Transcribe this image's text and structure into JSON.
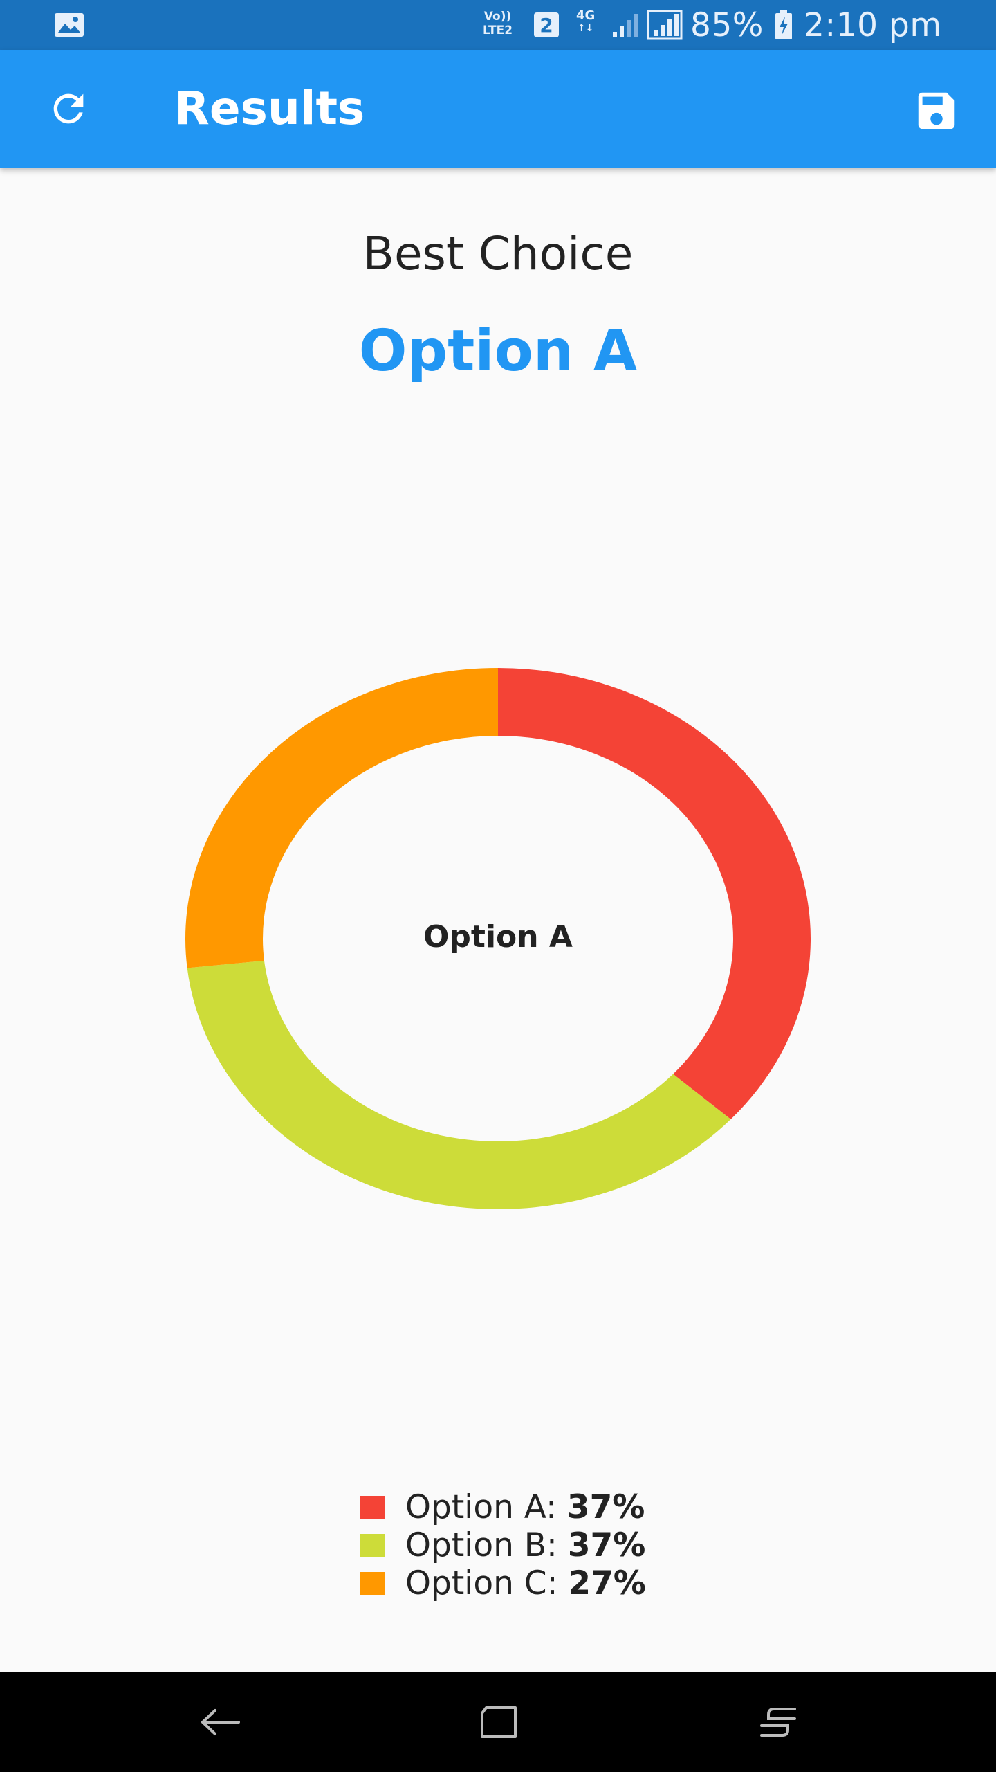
{
  "status_bar": {
    "volte_top": "Vo))",
    "volte_bottom": "LTE2",
    "sim": "2",
    "network": "4G",
    "network_arrows": "↑↓",
    "battery": "85%",
    "time": "2:10 pm"
  },
  "app_bar": {
    "title": "Results",
    "refresh_icon": "refresh-icon",
    "save_icon": "save-icon"
  },
  "result": {
    "label": "Best Choice",
    "winner": "Option A"
  },
  "chart_data": {
    "type": "pie",
    "center_label": "Option A",
    "slices": [
      {
        "name": "Option A",
        "value": 37,
        "color": "#f44336"
      },
      {
        "name": "Option B",
        "value": 37,
        "color": "#cddc39"
      },
      {
        "name": "Option C",
        "value": 27,
        "color": "#ff9800"
      }
    ]
  },
  "legend": [
    {
      "label": "Option A: ",
      "pct": "37%",
      "color": "#f44336"
    },
    {
      "label": "Option B: ",
      "pct": "37%",
      "color": "#cddc39"
    },
    {
      "label": "Option C: ",
      "pct": "27%",
      "color": "#ff9800"
    }
  ],
  "nav_bar": {
    "back_icon": "back-icon",
    "home_icon": "home-icon",
    "recents_icon": "recents-icon"
  }
}
